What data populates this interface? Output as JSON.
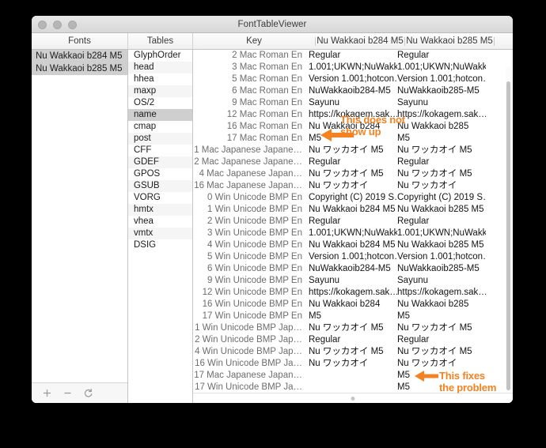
{
  "window": {
    "title": "FontTableViewer",
    "traffic_lights": [
      "close",
      "minimize",
      "zoom"
    ]
  },
  "headers": {
    "fonts": "Fonts",
    "tables": "Tables",
    "key": "Key",
    "col1": "Nu Wakkaoi b284 M5",
    "col2": "Nu Wakkaoi b285 M5"
  },
  "fonts_list": {
    "items": [
      {
        "label": "Nu Wakkaoi b284 M5",
        "selected": true
      },
      {
        "label": "Nu Wakkaoi b285 M5",
        "selected": true
      }
    ]
  },
  "fonts_toolbar": {
    "add_label": "+",
    "remove_label": "−",
    "reload_label": "reload"
  },
  "tables_list": {
    "items": [
      {
        "label": "GlyphOrder",
        "selected": false
      },
      {
        "label": "head",
        "selected": false
      },
      {
        "label": "hhea",
        "selected": false
      },
      {
        "label": "maxp",
        "selected": false
      },
      {
        "label": "OS/2",
        "selected": false
      },
      {
        "label": "name",
        "selected": true
      },
      {
        "label": "cmap",
        "selected": false
      },
      {
        "label": "post",
        "selected": false
      },
      {
        "label": "CFF",
        "selected": false
      },
      {
        "label": "GDEF",
        "selected": false
      },
      {
        "label": "GPOS",
        "selected": false
      },
      {
        "label": "GSUB",
        "selected": false
      },
      {
        "label": "VORG",
        "selected": false
      },
      {
        "label": "hmtx",
        "selected": false
      },
      {
        "label": "vhea",
        "selected": false
      },
      {
        "label": "vmtx",
        "selected": false
      },
      {
        "label": "DSIG",
        "selected": false
      }
    ]
  },
  "data_table": {
    "columns": [
      "Key",
      "Nu Wakkaoi b284 M5",
      "Nu Wakkaoi b285 M5"
    ],
    "rows": [
      {
        "key": "2 Mac Roman En",
        "v1": "Regular",
        "v2": "Regular"
      },
      {
        "key": "3 Mac Roman En",
        "v1": "1.001;UKWN;NuWakk…",
        "v2": "1.001;UKWN;NuWakk…"
      },
      {
        "key": "5 Mac Roman En",
        "v1": "Version 1.001;hotcon…",
        "v2": "Version 1.001;hotcon…"
      },
      {
        "key": "6 Mac Roman En",
        "v1": "NuWakkaoib284-M5",
        "v2": "NuWakkaoib285-M5"
      },
      {
        "key": "9 Mac Roman En",
        "v1": "Sayunu",
        "v2": "Sayunu"
      },
      {
        "key": "12 Mac Roman En",
        "v1": "https://kokagem.sak…",
        "v2": "https://kokagem.sak…"
      },
      {
        "key": "16 Mac Roman En",
        "v1": "Nu Wakkaoi b284",
        "v2": "Nu Wakkaoi b285"
      },
      {
        "key": "17 Mac Roman En",
        "v1": "M5",
        "v2": "M5"
      },
      {
        "key": "1 Mac Japanese Japane…",
        "v1": "Nu ワッカオイ M5",
        "v2": "Nu ワッカオイ M5"
      },
      {
        "key": "2 Mac Japanese Japane…",
        "v1": "Regular",
        "v2": "Regular"
      },
      {
        "key": "4 Mac Japanese Japan…",
        "v1": "Nu ワッカオイ M5",
        "v2": "Nu ワッカオイ M5"
      },
      {
        "key": "16 Mac Japanese Japan…",
        "v1": "Nu ワッカオイ",
        "v2": "Nu ワッカオイ"
      },
      {
        "key": "0 Win Unicode BMP En",
        "v1": "Copyright (C) 2019 S…",
        "v2": "Copyright (C) 2019 S…"
      },
      {
        "key": "1 Win Unicode BMP En",
        "v1": "Nu Wakkaoi b284 M5",
        "v2": "Nu Wakkaoi b285 M5"
      },
      {
        "key": "2 Win Unicode BMP En",
        "v1": "Regular",
        "v2": "Regular"
      },
      {
        "key": "3 Win Unicode BMP En",
        "v1": "1.001;UKWN;NuWakk…",
        "v2": "1.001;UKWN;NuWakk…"
      },
      {
        "key": "4 Win Unicode BMP En",
        "v1": "Nu Wakkaoi b284 M5",
        "v2": "Nu Wakkaoi b285 M5"
      },
      {
        "key": "5 Win Unicode BMP En",
        "v1": "Version 1.001;hotcon…",
        "v2": "Version 1.001;hotcon…"
      },
      {
        "key": "6 Win Unicode BMP En",
        "v1": "NuWakkaoib284-M5",
        "v2": "NuWakkaoib285-M5"
      },
      {
        "key": "9 Win Unicode BMP En",
        "v1": "Sayunu",
        "v2": "Sayunu"
      },
      {
        "key": "12 Win Unicode BMP En",
        "v1": "https://kokagem.sak…",
        "v2": "https://kokagem.sak…"
      },
      {
        "key": "16 Win Unicode BMP En",
        "v1": "Nu Wakkaoi b284",
        "v2": "Nu Wakkaoi b285"
      },
      {
        "key": "17 Win Unicode BMP En",
        "v1": "M5",
        "v2": "M5"
      },
      {
        "key": "1 Win Unicode BMP Jap…",
        "v1": "Nu ワッカオイ M5",
        "v2": "Nu ワッカオイ M5"
      },
      {
        "key": "2 Win Unicode BMP Jap…",
        "v1": "Regular",
        "v2": "Regular"
      },
      {
        "key": "4 Win Unicode BMP Jap…",
        "v1": "Nu ワッカオイ M5",
        "v2": "Nu ワッカオイ M5"
      },
      {
        "key": "16 Win Unicode BMP Ja…",
        "v1": "Nu ワッカオイ",
        "v2": "Nu ワッカオイ"
      },
      {
        "key": "17 Mac Japanese Japan…",
        "v1": "",
        "v2": "M5"
      },
      {
        "key": "17 Win Unicode BMP Ja…",
        "v1": "",
        "v2": "M5"
      }
    ]
  },
  "annotations": {
    "color": "#f58220",
    "first": {
      "line1": "This does not",
      "line2": "show up"
    },
    "second": {
      "line1": "This fixes",
      "line2": "the problem"
    }
  }
}
